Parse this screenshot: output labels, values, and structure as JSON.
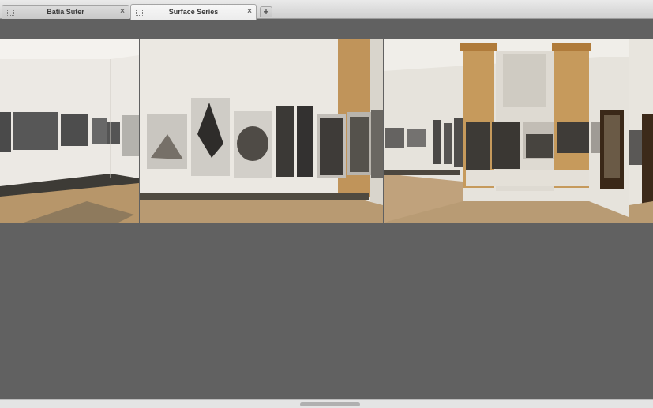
{
  "tabs": [
    {
      "title": "Batia Suter",
      "close": "×",
      "active": false
    },
    {
      "title": "Surface Series",
      "close": "×",
      "active": true
    }
  ],
  "new_tab_label": "+",
  "colors": {
    "background": "#616161",
    "tabbar": "#d9d9d9",
    "active_tab": "#f2f2f2"
  },
  "icons": {
    "favicon": "page-icon",
    "close": "close-icon",
    "new_tab": "plus-icon"
  },
  "content": {
    "images": [
      "gallery-photo-1",
      "gallery-photo-2",
      "gallery-photo-3",
      "gallery-photo-4"
    ]
  }
}
